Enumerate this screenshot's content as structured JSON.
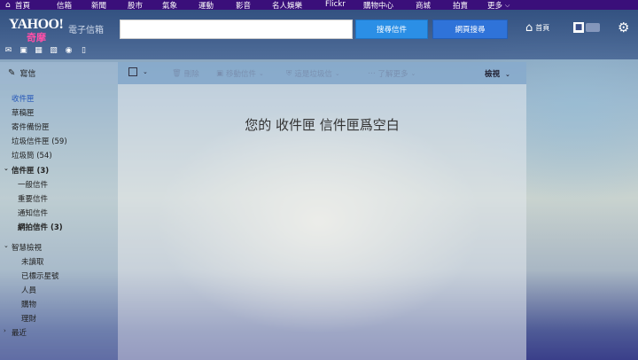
{
  "topnav": {
    "items": [
      "首頁",
      "信箱",
      "新聞",
      "股市",
      "氣象",
      "運動",
      "影音",
      "名人娛樂",
      "Flickr",
      "購物中心",
      "商城",
      "拍賣",
      "更多"
    ],
    "home_icon": "home-icon",
    "more_caret": "chevron-down-icon"
  },
  "header": {
    "logo_text": "YAHOO!",
    "logo_sub": "奇摩",
    "logo_service": "電子信箱",
    "search_value": "",
    "search_mail_label": "搜尋信件",
    "search_web_label": "網頁搜尋",
    "home_label": "首頁",
    "settings_icon": "gear-icon"
  },
  "toolicons": [
    "mail-icon",
    "contacts-icon",
    "calendar-icon",
    "notepad-icon",
    "messenger-icon",
    "mobile-icon"
  ],
  "sidebar": {
    "compose_label": "寫信",
    "folders": [
      {
        "label": "收件匣",
        "active": true
      },
      {
        "label": "草稿匣"
      },
      {
        "label": "寄件備份匣"
      },
      {
        "label": "垃圾信件匣 (59)"
      },
      {
        "label": "垃圾筒 (54)"
      }
    ],
    "inbox_group": {
      "label": "信件匣 (3)",
      "children": [
        "一般信件",
        "重要信件",
        "通知信件",
        "網拍信件  (3)"
      ]
    },
    "smart_views": {
      "label": "智慧檢視",
      "children": [
        "未讀取",
        "已標示星號",
        "人員",
        "購物",
        "理財"
      ]
    },
    "recent": {
      "label": "最近"
    }
  },
  "toolbar": {
    "delete_label": "刪除",
    "move_label": "移動信件",
    "spam_label": "這是垃圾信",
    "more_label": "了解更多",
    "view_label": "檢視"
  },
  "main": {
    "empty_message": "您的 收件匣 信件匣爲空白"
  },
  "colors": {
    "topbar": "#3a0f7a",
    "search_mail_button": "#2b8fe6",
    "search_web_button": "#2f73d9",
    "active_folder": "#2456b8"
  }
}
